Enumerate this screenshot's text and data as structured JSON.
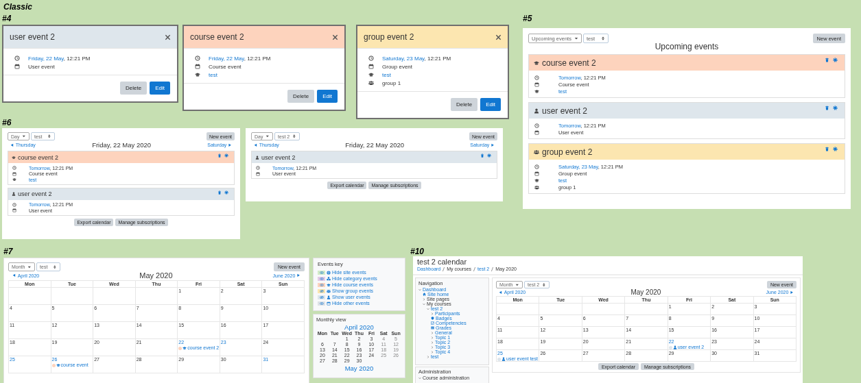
{
  "title": "Classic",
  "modals_section": {
    "label": "#4",
    "modals": [
      {
        "title": "user event 2",
        "color": "#dee6ec",
        "details": [
          {
            "kind": "clock",
            "link": "Friday, 22 May",
            "text": ", 12:21 PM"
          },
          {
            "kind": "calendar",
            "text": "User event"
          }
        ],
        "buttons": [
          {
            "label": "Delete",
            "kind": "secondary"
          },
          {
            "label": "Edit",
            "kind": "primary"
          }
        ]
      },
      {
        "title": "course event 2",
        "color": "#fdd3bd",
        "details": [
          {
            "kind": "clock",
            "link": "Friday, 22 May",
            "text": ", 12:21 PM"
          },
          {
            "kind": "calendar",
            "text": "Course event"
          },
          {
            "kind": "course",
            "link": "test"
          }
        ],
        "buttons": [
          {
            "label": "Delete",
            "kind": "secondary"
          },
          {
            "label": "Edit",
            "kind": "primary"
          }
        ]
      },
      {
        "title": "group event 2",
        "color": "#fce6b0",
        "details": [
          {
            "kind": "clock",
            "link": "Saturday, 23 May",
            "text": ", 12:21 PM"
          },
          {
            "kind": "calendar",
            "text": "Group event"
          },
          {
            "kind": "course",
            "link": "test"
          },
          {
            "kind": "group",
            "text": "group 1"
          }
        ],
        "buttons": [
          {
            "label": "Delete",
            "kind": "secondary"
          },
          {
            "label": "Edit",
            "kind": "primary"
          }
        ]
      }
    ]
  },
  "upcoming_section": {
    "label": "#5",
    "view_select": "Upcoming events",
    "course_select": "test",
    "new_event": "New event",
    "heading": "Upcoming events",
    "events": [
      {
        "kind": "course",
        "title": "course event 2",
        "color": "#fdd3bd",
        "details": [
          {
            "kind": "clock",
            "link": "Tomorrow",
            "text": ", 12:21 PM"
          },
          {
            "kind": "calendar",
            "text": "Course event"
          },
          {
            "kind": "course",
            "link": "test"
          }
        ]
      },
      {
        "kind": "user",
        "title": "user event 2",
        "color": "#dee6ec",
        "details": [
          {
            "kind": "clock",
            "link": "Tomorrow",
            "text": ", 12:21 PM"
          },
          {
            "kind": "calendar",
            "text": "User event"
          }
        ]
      },
      {
        "kind": "group",
        "title": "group event 2",
        "color": "#fce6b0",
        "details": [
          {
            "kind": "clock",
            "link": "Saturday, 23 May",
            "text": ", 12:21 PM"
          },
          {
            "kind": "calendar",
            "text": "Group event"
          },
          {
            "kind": "course",
            "link": "test"
          },
          {
            "kind": "group",
            "text": "group 1"
          }
        ]
      }
    ]
  },
  "day_section": {
    "label": "#6",
    "views": [
      {
        "view_select": "Day",
        "course_select": "test",
        "new_event": "New event",
        "prev": "Thursday",
        "next": "Saturday",
        "heading": "Friday, 22 May 2020",
        "events": [
          {
            "kind": "course",
            "title": "course event 2",
            "color": "#fdd3bd",
            "details": [
              {
                "kind": "clock",
                "link": "Tomorrow",
                "text": ", 12:21 PM"
              },
              {
                "kind": "calendar",
                "text": "Course event"
              },
              {
                "kind": "course",
                "link": "test"
              }
            ]
          },
          {
            "kind": "user",
            "title": "user event 2",
            "color": "#dee6ec",
            "details": [
              {
                "kind": "clock",
                "link": "Tomorrow",
                "text": ", 12:21 PM"
              },
              {
                "kind": "calendar",
                "text": "User event"
              }
            ]
          }
        ],
        "buttons": [
          "Export calendar",
          "Manage subscriptions"
        ]
      },
      {
        "view_select": "Day",
        "course_select": "test 2",
        "new_event": "New event",
        "prev": "Thursday",
        "next": "Saturday",
        "heading": "Friday, 22 May 2020",
        "events": [
          {
            "kind": "user",
            "title": "user event 2",
            "color": "#dee6ec",
            "details": [
              {
                "kind": "clock",
                "link": "Tomorrow",
                "text": ", 12:21 PM"
              },
              {
                "kind": "calendar",
                "text": "User event"
              }
            ]
          }
        ],
        "buttons": [
          "Export calendar",
          "Manage subscriptions"
        ]
      }
    ]
  },
  "month_section": {
    "label": "#7",
    "calendar": {
      "view_select": "Month",
      "course_select": "test",
      "new_event": "New event",
      "prev": "April 2020",
      "next": "June 2020",
      "heading": "May 2020",
      "weekdays": [
        "Mon",
        "Tue",
        "Wed",
        "Thu",
        "Fri",
        "Sat",
        "Sun"
      ],
      "weeks": [
        [
          {
            "day": "1",
            "link": false
          },
          {
            "day": "2",
            "link": false
          },
          {
            "day": "3",
            "link": false
          }
        ],
        [
          {
            "day": "4",
            "link": false
          },
          {
            "day": "5",
            "link": false
          },
          {
            "day": "6",
            "link": false
          },
          {
            "day": "7",
            "link": false
          },
          {
            "day": "8",
            "link": false
          },
          {
            "day": "9",
            "link": false
          },
          {
            "day": "10",
            "link": false
          }
        ],
        [
          {
            "day": "11",
            "link": false
          },
          {
            "day": "12",
            "link": false
          },
          {
            "day": "13",
            "link": false
          },
          {
            "day": "14",
            "link": false
          },
          {
            "day": "15",
            "link": false
          },
          {
            "day": "16",
            "link": false
          },
          {
            "day": "17",
            "link": false
          }
        ],
        [
          {
            "day": "18",
            "link": false
          },
          {
            "day": "19",
            "link": false
          },
          {
            "day": "20",
            "link": false
          },
          {
            "day": "21",
            "link": false
          },
          {
            "day": "22",
            "link": true,
            "events": [
              {
                "kind": "course",
                "title": "course event 2",
                "color": "#fdd3bd"
              }
            ]
          },
          {
            "day": "23",
            "link": true
          },
          {
            "day": "24",
            "link": false
          }
        ],
        [
          {
            "day": "25",
            "link": true
          },
          {
            "day": "26",
            "link": true,
            "events": [
              {
                "kind": "course",
                "title": "course event",
                "color": "#fdd3bd"
              }
            ]
          },
          {
            "day": "27",
            "link": false
          },
          {
            "day": "28",
            "link": false
          },
          {
            "day": "29",
            "link": false
          },
          {
            "day": "30",
            "link": false
          },
          {
            "day": "31",
            "link": true
          }
        ]
      ]
    },
    "events_key": {
      "title": "Events key",
      "items": [
        {
          "kind": "site",
          "label": "Hide site events",
          "color": "#d3ebc8",
          "shown": true
        },
        {
          "kind": "category",
          "label": "Hide category events",
          "color": "#e3cbe6",
          "shown": true
        },
        {
          "kind": "course",
          "label": "Hide course events",
          "color": "#fdd3bd",
          "shown": true
        },
        {
          "kind": "group",
          "label": "Show group events",
          "color": "#fce6b0",
          "shown": false
        },
        {
          "kind": "user",
          "label": "Show user events",
          "color": "#dee6ec",
          "shown": false
        },
        {
          "kind": "other",
          "label": "Hide other events",
          "color": "#dee2e6",
          "shown": true
        }
      ]
    },
    "monthly_view": {
      "title": "Monthly view",
      "months": [
        {
          "heading": "April 2020",
          "weekdays": [
            "Mon",
            "Tue",
            "Wed",
            "Thu",
            "Fri",
            "Sat",
            "Sun"
          ],
          "weeks": [
            [
              "1",
              "2",
              "3",
              "4",
              "5"
            ],
            [
              "6",
              "7",
              "8",
              "9",
              "10",
              "11",
              "12"
            ],
            [
              "13",
              "14",
              "15",
              "16",
              "17",
              "18",
              "19"
            ],
            [
              "20",
              "21",
              "22",
              "23",
              "24",
              "25",
              "26"
            ],
            [
              "27",
              "28",
              "29",
              "30"
            ]
          ]
        },
        {
          "heading": "May 2020"
        }
      ]
    }
  },
  "course_section": {
    "label": "#10",
    "page_title": "test 2 calendar",
    "breadcrumb": [
      {
        "label": "Dashboard",
        "link": true
      },
      {
        "label": "My courses",
        "link": false
      },
      {
        "label": "test 2",
        "link": true
      },
      {
        "label": "May 2020",
        "link": false
      }
    ],
    "navigation": {
      "title": "Navigation",
      "tree": [
        {
          "kind": "branch",
          "label": "Dashboard",
          "link": true,
          "expanded": true,
          "children": [
            {
              "kind": "home",
              "label": "Site home",
              "link": true
            },
            {
              "kind": "branch",
              "label": "Site pages",
              "link": false,
              "expanded": false
            },
            {
              "kind": "branch",
              "label": "My courses",
              "link": false,
              "expanded": true,
              "children": [
                {
                  "kind": "branch",
                  "label": "test 2",
                  "link": true,
                  "expanded": true,
                  "children": [
                    {
                      "kind": "branch",
                      "label": "Participants",
                      "link": true,
                      "expanded": false
                    },
                    {
                      "kind": "badges",
                      "label": "Badges",
                      "link": true
                    },
                    {
                      "kind": "competencies",
                      "label": "Competencies",
                      "link": true
                    },
                    {
                      "kind": "grades",
                      "label": "Grades",
                      "link": true
                    },
                    {
                      "kind": "branch",
                      "label": "General",
                      "link": true,
                      "expanded": false
                    },
                    {
                      "kind": "branch",
                      "label": "Topic 1",
                      "link": true,
                      "expanded": false
                    },
                    {
                      "kind": "branch",
                      "label": "Topic 2",
                      "link": true,
                      "expanded": false
                    },
                    {
                      "kind": "branch",
                      "label": "Topic 3",
                      "link": true,
                      "expanded": false
                    },
                    {
                      "kind": "branch",
                      "label": "Topic 4",
                      "link": true,
                      "expanded": false
                    }
                  ]
                },
                {
                  "kind": "branch",
                  "label": "test",
                  "link": true,
                  "expanded": false
                }
              ]
            }
          ]
        }
      ]
    },
    "administration": {
      "title": "Administration",
      "tree": [
        {
          "kind": "branch",
          "label": "Course administration",
          "link": false,
          "expanded": true
        }
      ]
    },
    "calendar": {
      "view_select": "Month",
      "course_select": "test 2",
      "new_event": "New event",
      "prev": "April 2020",
      "next": "June 2020",
      "heading": "May 2020",
      "weekdays": [
        "Mon",
        "Tue",
        "Wed",
        "Thu",
        "Fri",
        "Sat",
        "Sun"
      ],
      "weeks": [
        [
          {
            "day": "1",
            "link": false
          },
          {
            "day": "2",
            "link": false
          },
          {
            "day": "3",
            "link": false
          }
        ],
        [
          {
            "day": "4",
            "link": false
          },
          {
            "day": "5",
            "link": false
          },
          {
            "day": "6",
            "link": false
          },
          {
            "day": "7",
            "link": false
          },
          {
            "day": "8",
            "link": false
          },
          {
            "day": "9",
            "link": false
          },
          {
            "day": "10",
            "link": false
          }
        ],
        [
          {
            "day": "11",
            "link": false
          },
          {
            "day": "12",
            "link": false
          },
          {
            "day": "13",
            "link": false
          },
          {
            "day": "14",
            "link": false
          },
          {
            "day": "15",
            "link": false
          },
          {
            "day": "16",
            "link": false
          },
          {
            "day": "17",
            "link": false
          }
        ],
        [
          {
            "day": "18",
            "link": false
          },
          {
            "day": "19",
            "link": false
          },
          {
            "day": "20",
            "link": false
          },
          {
            "day": "21",
            "link": false
          },
          {
            "day": "22",
            "link": true,
            "events": [
              {
                "kind": "user",
                "title": "user event 2",
                "color": "#dee6ec"
              }
            ]
          },
          {
            "day": "23",
            "link": false
          },
          {
            "day": "24",
            "link": false
          }
        ],
        [
          {
            "day": "25",
            "link": true,
            "events": [
              {
                "kind": "user",
                "title": "user event test",
                "color": "#dee6ec"
              }
            ]
          },
          {
            "day": "26",
            "link": false
          },
          {
            "day": "27",
            "link": false
          },
          {
            "day": "28",
            "link": false
          },
          {
            "day": "29",
            "link": false
          },
          {
            "day": "30",
            "link": false
          },
          {
            "day": "31",
            "link": false
          }
        ]
      ],
      "buttons": [
        "Export calendar",
        "Manage subscriptions"
      ]
    }
  }
}
